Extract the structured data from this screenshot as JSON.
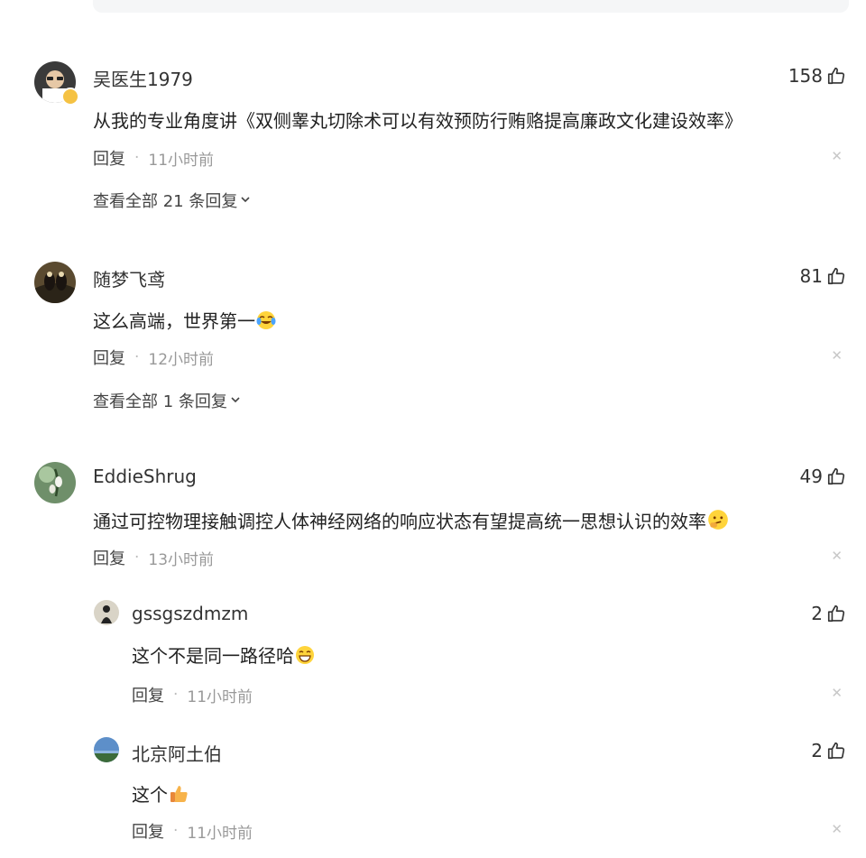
{
  "comments": [
    {
      "name": "吴医生1979",
      "likes": "158",
      "text": "从我的专业角度讲《双侧睾丸切除术可以有效预防行贿赂提高廉政文化建设效率》",
      "reply_label": "回复",
      "time": "11小时前",
      "expand_label": "查看全部 21 条回复"
    },
    {
      "name": "随梦飞鸢",
      "likes": "81",
      "text": "这么高端，世界第一",
      "reply_label": "回复",
      "time": "12小时前",
      "expand_label": "查看全部 1 条回复"
    },
    {
      "name": "EddieShrug",
      "likes": "49",
      "text": "通过可控物理接触调控人体神经网络的响应状态有望提高统一思想认识的效率",
      "reply_label": "回复",
      "time": "13小时前"
    }
  ],
  "replies": [
    {
      "name": "gssgszdmzm",
      "likes": "2",
      "text": "这个不是同一路径哈",
      "reply_label": "回复",
      "time": "11小时前"
    },
    {
      "name": "北京阿土伯",
      "likes": "2",
      "text": "这个",
      "reply_label": "回复",
      "time": "11小时前"
    }
  ],
  "icons": {
    "like": "thumbs-up-icon",
    "close": "close-icon",
    "expand": "chevron-down-icon"
  }
}
